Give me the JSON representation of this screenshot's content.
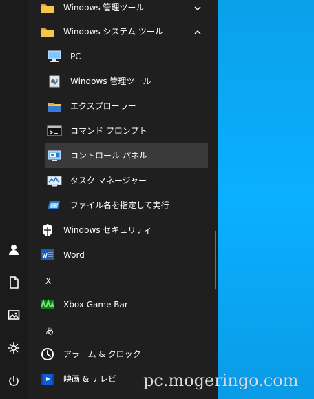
{
  "colors": {
    "menu_bg": "#1f1f1f",
    "rail_bg": "#1b1b1b",
    "selected_row": "#3a3a3a",
    "text": "#ffffff",
    "desktop_blue": "#0aa0ea"
  },
  "rail": [
    {
      "icon": "user-icon"
    },
    {
      "icon": "document-icon"
    },
    {
      "icon": "pictures-icon"
    },
    {
      "icon": "settings-gear-icon"
    },
    {
      "icon": "power-icon"
    }
  ],
  "menu": {
    "items": [
      {
        "label": "Windows 管理ツール",
        "icon": "folder-icon",
        "chevron": "down"
      },
      {
        "label": "Windows システム ツール",
        "icon": "folder-icon",
        "chevron": "up"
      },
      {
        "label": "PC",
        "icon": "pc-icon"
      },
      {
        "label": "Windows 管理ツール",
        "icon": "admin-tools-icon"
      },
      {
        "label": "エクスプローラー",
        "icon": "file-explorer-icon"
      },
      {
        "label": "コマンド プロンプト",
        "icon": "command-prompt-icon"
      },
      {
        "label": "コントロール パネル",
        "icon": "control-panel-icon",
        "selected": true
      },
      {
        "label": "タスク マネージャー",
        "icon": "task-manager-icon"
      },
      {
        "label": "ファイル名を指定して実行",
        "icon": "run-icon"
      },
      {
        "label": "Windows セキュリティ",
        "icon": "shield-icon"
      },
      {
        "label": "Word",
        "icon": "word-icon"
      },
      {
        "label": "X",
        "kind": "section"
      },
      {
        "label": "Xbox Game Bar",
        "icon": "xbox-game-bar-icon"
      },
      {
        "label": "あ",
        "kind": "section"
      },
      {
        "label": "アラーム & クロック",
        "icon": "alarm-clock-icon"
      },
      {
        "label": "映画 & テレビ",
        "icon": "movies-tv-icon"
      }
    ]
  },
  "watermark": "pc.mogeringo.com"
}
